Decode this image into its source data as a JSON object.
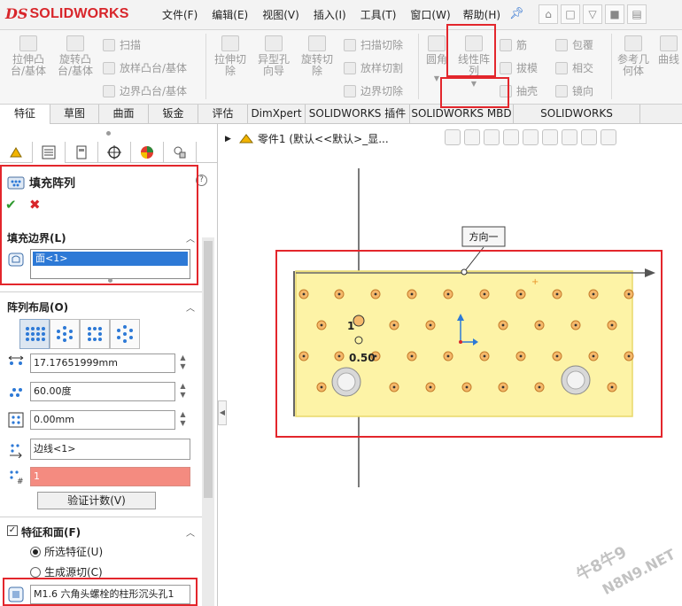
{
  "app": {
    "logo_ds": "DS",
    "logo_text": "SOLIDWORKS"
  },
  "menu": [
    "文件(F)",
    "编辑(E)",
    "视图(V)",
    "插入(I)",
    "工具(T)",
    "窗口(W)",
    "帮助(H)"
  ],
  "ribbon": {
    "extrude_boss": "拉伸凸\n台/基体",
    "revolve_boss": "旋转凸\n台/基体",
    "sweep": "扫描",
    "loft_boss": "放样凸台/基体",
    "boundary_boss": "边界凸台/基体",
    "extrude_cut": "拉伸切\n除",
    "hole_wizard": "异型孔\n向导",
    "revolve_cut": "旋转切\n除",
    "sweep_cut": "扫描切除",
    "loft_cut": "放样切割",
    "boundary_cut": "边界切除",
    "fillet": "圆角",
    "linear_pattern": "线性阵\n列",
    "rib": "筋",
    "draft": "拔模",
    "shell": "抽壳",
    "wrap": "包覆",
    "intersect": "相交",
    "mirror": "镜向",
    "ref_geometry": "参考几\n何体",
    "curves": "曲线"
  },
  "tabs": [
    "特征",
    "草图",
    "曲面",
    "钣金",
    "评估",
    "DimXpert",
    "SOLIDWORKS 插件",
    "SOLIDWORKS MBD",
    "SOLIDWORKS Inspection"
  ],
  "panel": {
    "title": "填充阵列",
    "help": "?",
    "fill_boundary_header": "填充边界(L)",
    "fill_boundary_item": "面<1>",
    "pattern_layout_header": "阵列布局(O)",
    "spacing": "17.17651999mm",
    "angle": "60.00度",
    "margin": "0.00mm",
    "direction_edge": "边线<1>",
    "instance_count": "1",
    "verify_count": "验证计数(V)",
    "features_faces_header": "特征和面(F)",
    "selected_features": "所选特征(U)",
    "create_seed_cut": "生成源切(C)",
    "feature_item": "M1.6 六角头螺栓的柱形沉头孔1"
  },
  "graphics": {
    "tree_label": "零件1  (默认<<默认>_显...",
    "callout": "方向一",
    "dim_label": "0.50",
    "dim_tag": "1"
  },
  "watermark": {
    "line1": "牛8牛9",
    "line2": "N8N9.NET"
  },
  "colors": {
    "accent_red": "#e3262c",
    "selection_blue": "#2d79d6",
    "face_yellow": "#fdf3a6",
    "count_error": "#f48b80"
  }
}
